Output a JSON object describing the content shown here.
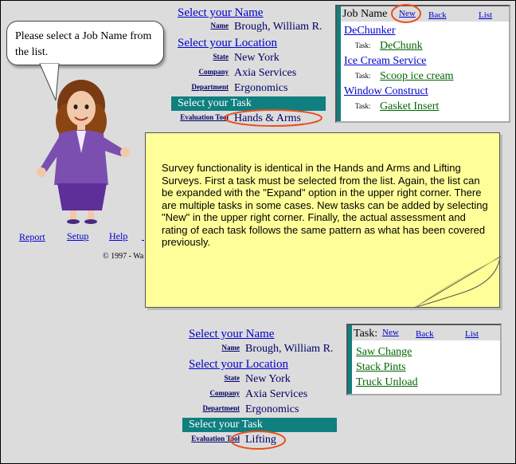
{
  "bubble": {
    "text": "Please select a Job Name from the list."
  },
  "top_form": {
    "select_name_link": "Select your Name",
    "name_label": "Name",
    "name_value": "Brough, William R.",
    "select_location_link": "Select your Location",
    "state_label": "State",
    "state_value": "New York",
    "company_label": "Company",
    "company_value": "Axia Services",
    "department_label": "Department",
    "department_value": "Ergonomics",
    "select_task_bar": "Select your Task",
    "eval_tool_label": "Evaluation Tool",
    "eval_tool_value": "Hands & Arms"
  },
  "job_list": {
    "header_label": "Job Name",
    "new_link": "New",
    "back_link": "Back",
    "list_link": "List",
    "task_label": "Task:",
    "items": [
      {
        "job": "DeChunker",
        "task": "DeChunk"
      },
      {
        "job": "Ice Cream Service",
        "task": "Scoop ice cream"
      },
      {
        "job": "Window Construct",
        "task": "Gasket Insert"
      }
    ]
  },
  "bottom_nav": {
    "report": "Report",
    "setup": "Setup",
    "help": "Help",
    "copyright": "© 1997 - Wa"
  },
  "note": {
    "text": "Survey functionality is identical in the Hands and Arms and Lifting Surveys.  First a task must be selected from the list.  Again, the list can be expanded with the \"Expand\" option in the upper right corner.  There are multiple tasks in some cases.  New tasks can be added by selecting \"New\" in the upper right corner.  Finally, the actual assessment and rating of each task follows the same pattern as what has been covered previously."
  },
  "bottom_form": {
    "select_name_link": "Select your Name",
    "name_label": "Name",
    "name_value": "Brough, William R.",
    "select_location_link": "Select your Location",
    "state_label": "State",
    "state_value": "New York",
    "company_label": "Company",
    "company_value": "Axia Services",
    "department_label": "Department",
    "department_value": "Ergonomics",
    "select_task_bar": "Select your Task",
    "eval_tool_label": "Evaluation Tool",
    "eval_tool_value": "Lifting"
  },
  "task_list": {
    "header_label": "Task:",
    "new_link": "New",
    "back_link": "Back",
    "list_link": "List",
    "items": [
      "Saw Change",
      "Stack Pints",
      "Truck Unload"
    ]
  },
  "colors": {
    "teal": "#0f7f7f",
    "highlight_ellipse": "#e8501e",
    "note_yellow": "#ffff99",
    "background": "#dcdcdc"
  }
}
